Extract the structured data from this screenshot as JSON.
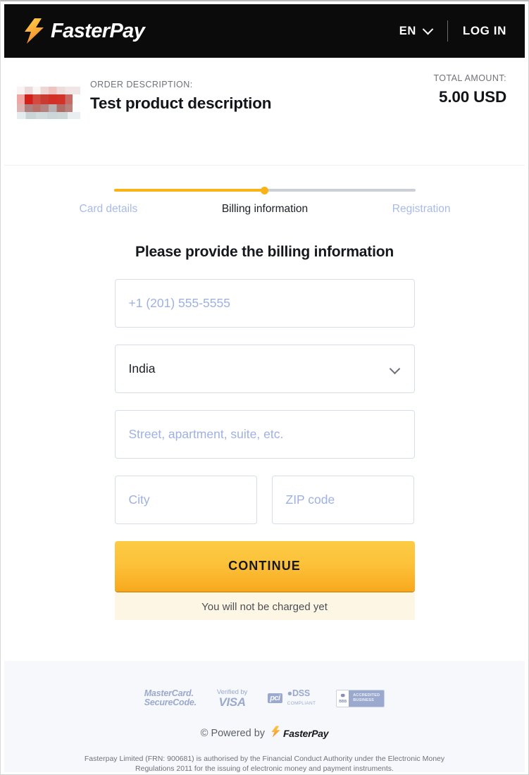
{
  "topbar": {
    "brand_name": "FasterPay",
    "brand_icon": "lightning-bolt-icon",
    "language": "EN",
    "language_chevron_icon": "chevron-down-icon",
    "login_label": "LOG IN",
    "background_color": "#0b0b0b"
  },
  "order": {
    "description_label": "ORDER DESCRIPTION:",
    "description_value": "Test product description",
    "amount_label": "TOTAL AMOUNT:",
    "amount_value": "5.00 USD",
    "thumbnail_alt": "redacted-product-thumbnail"
  },
  "progress": {
    "percent": 50,
    "active_color": "#f8b417",
    "inactive_color": "#ccd0d6",
    "steps": [
      {
        "label": "Card details",
        "state": "done"
      },
      {
        "label": "Billing information",
        "state": "active"
      },
      {
        "label": "Registration",
        "state": "upcoming"
      }
    ]
  },
  "form": {
    "heading": "Please provide the billing information",
    "phone": {
      "placeholder": "+1 (201) 555-5555",
      "value": ""
    },
    "country": {
      "value": "India",
      "chevron_icon": "chevron-down-icon"
    },
    "street": {
      "placeholder": "Street, apartment, suite, etc.",
      "value": ""
    },
    "city": {
      "placeholder": "City",
      "value": ""
    },
    "zip": {
      "placeholder": "ZIP code",
      "value": ""
    },
    "submit_label": "CONTINUE",
    "charge_note": "You will not be charged yet",
    "accent_color": "#f8b417"
  },
  "footer": {
    "badges": [
      {
        "name": "mastercard-securecode-badge",
        "line1": "MasterCard.",
        "line2": "SecureCode."
      },
      {
        "name": "verified-by-visa-badge",
        "line1": "Verified by",
        "line2": "VISA"
      },
      {
        "name": "pci-dss-badge",
        "mark": "pci",
        "line1": "●DSS",
        "line2": "COMPLIANT"
      },
      {
        "name": "bbb-accredited-badge",
        "mark": "BBB",
        "line1": "ACCREDITED",
        "line2": "BUSINESS"
      }
    ],
    "powered_by": "© Powered by",
    "powered_brand": "FasterPay",
    "legal": "Fasterpay Limited (FRN: 900681) is authorised by the Financial Conduct Authority under the Electronic Money Regulations 2011 for the issuing of electronic money and payment instruments.",
    "background_color": "#f7f8fc"
  }
}
